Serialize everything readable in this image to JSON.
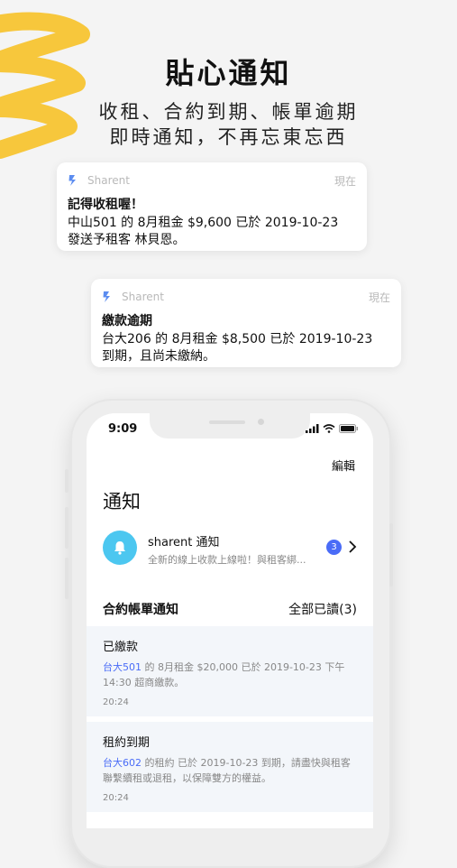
{
  "hero": {
    "title": "貼心通知",
    "subtitle_line1": "收租、合約到期、帳單逾期",
    "subtitle_line2": "即時通知，不再忘東忘西"
  },
  "colors": {
    "brush": "#f7c73c",
    "accent": "#4a6cf7",
    "bell": "#4cc7f0"
  },
  "push_cards": [
    {
      "app": "Sharent",
      "time": "現在",
      "title": "記得收租喔！",
      "line1": "中山501 的 8月租金 $9,600 已於 2019-10-23",
      "line2": "發送予租客 林貝恩。"
    },
    {
      "app": "Sharent",
      "time": "現在",
      "title": "繳款逾期",
      "line1": "台大206 的 8月租金 $8,500 已於 2019-10-23",
      "line2": "到期，且尚未繳納。"
    }
  ],
  "phone": {
    "status_time": "9:09",
    "edit_label": "編輯",
    "title": "通知",
    "system": {
      "name": "sharent 通知",
      "preview": "全新的線上收款上線啦！與租客綁...",
      "badge": "3",
      "icon": "bell-icon"
    },
    "section": {
      "title": "合約帳單通知",
      "mark_all": "全部已讀(3)"
    },
    "notifications": [
      {
        "title": "已繳款",
        "link": "台大501",
        "body": " 的 8月租金 $20,000 已於 2019-10-23 下午14:30 超商繳款。",
        "time": "20:24"
      },
      {
        "title": "租約到期",
        "link": "台大602",
        "body": " 的租約 已於 2019-10-23 到期，請盡快與租客聯繫續租或退租，以保障雙方的權益。",
        "time": "20:24"
      }
    ]
  }
}
